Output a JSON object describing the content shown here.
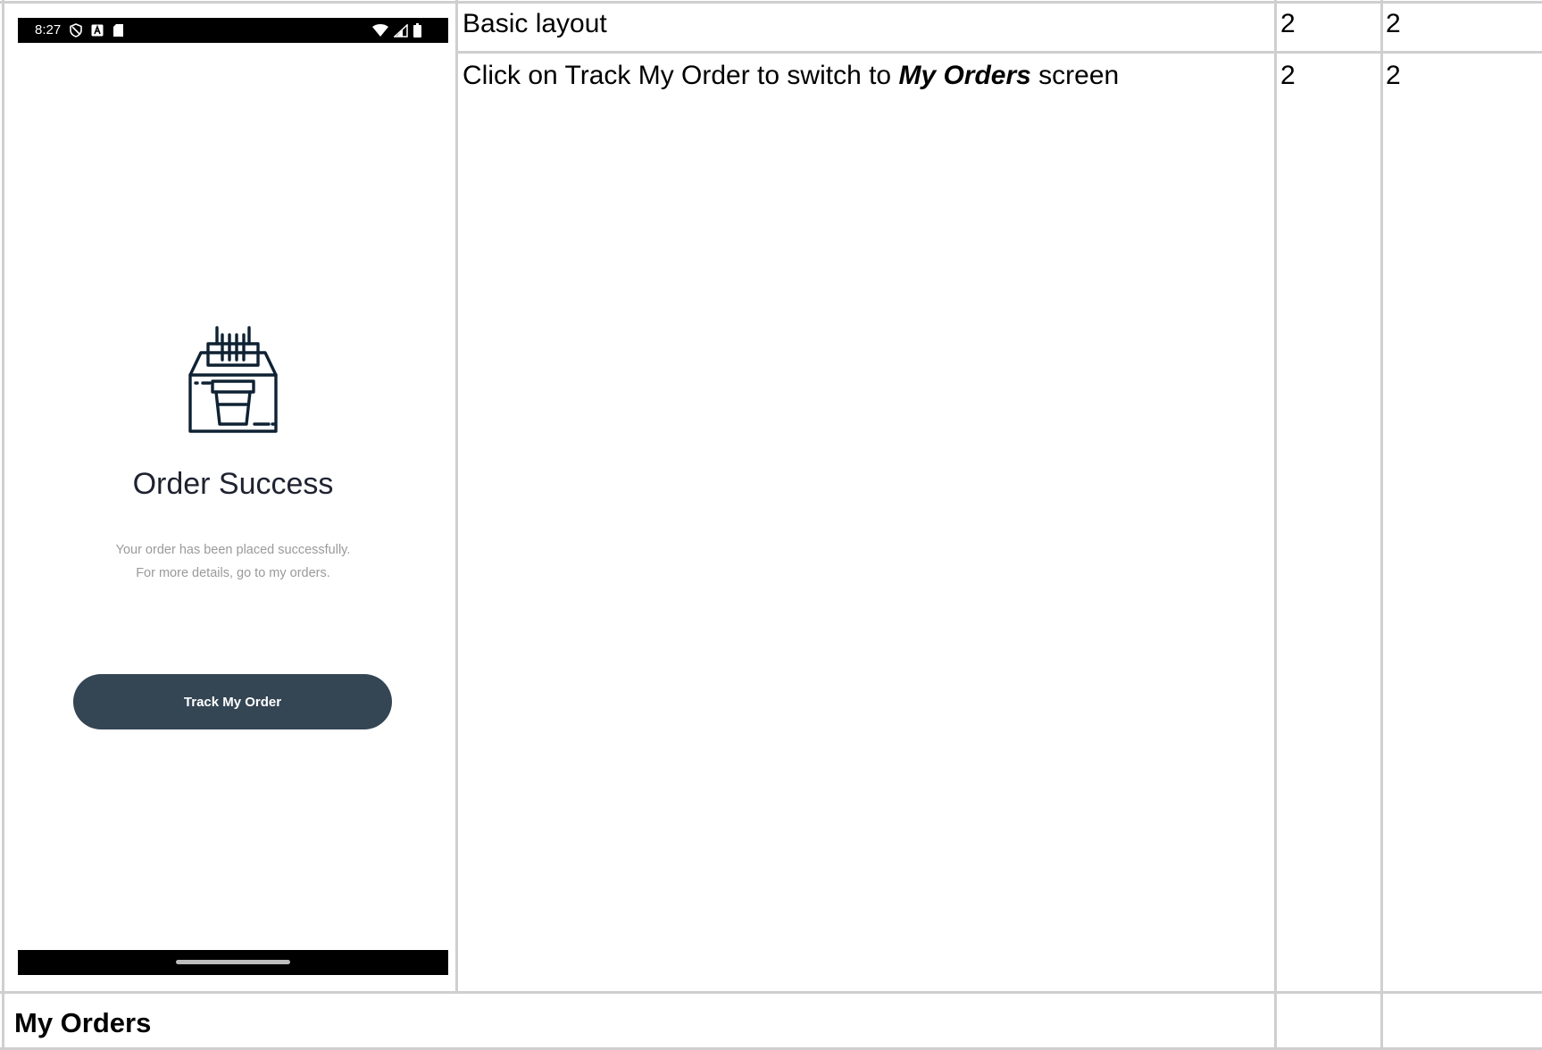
{
  "phone": {
    "status_time": "8:27",
    "title": "Order Success",
    "subtitle_line1": "Your order has been placed successfully.",
    "subtitle_line2": "For more details, go to my orders.",
    "button_label": "Track My Order",
    "button_color": "#344554",
    "icons": [
      "shield-icon",
      "a-icon",
      "sd-card-icon",
      "wifi-icon",
      "signal-icon",
      "battery-icon",
      "order-box-coffee-icon"
    ]
  },
  "rows": [
    {
      "text": "Basic layout",
      "col2": "2",
      "col3": "2"
    },
    {
      "text_before": "Click on Track My Order to switch to ",
      "text_emphasis": "My Orders",
      "text_after": " screen",
      "col2": "2",
      "col3": "2"
    }
  ],
  "section": {
    "title": "My Orders"
  }
}
